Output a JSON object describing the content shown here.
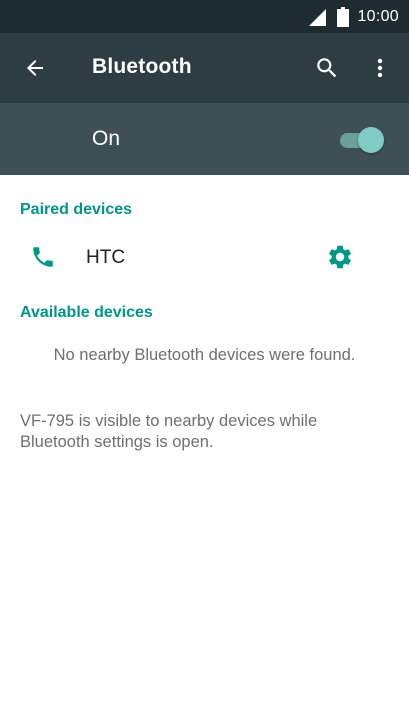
{
  "status_bar": {
    "time": "10:00",
    "icons": [
      "signal-icon",
      "battery-icon"
    ]
  },
  "app_bar": {
    "title": "Bluetooth",
    "icons": [
      "back-arrow-icon",
      "search-icon",
      "more-vert-icon"
    ]
  },
  "master_switch": {
    "label": "On",
    "checked": true
  },
  "paired_devices": {
    "header": "Paired devices",
    "items": [
      {
        "name": "HTC",
        "icon": "phone-icon",
        "action_icon": "gear-icon"
      }
    ]
  },
  "available_devices": {
    "header": "Available devices",
    "empty_message": "No nearby Bluetooth devices were found."
  },
  "footer_message": "VF-795 is visible to nearby devices while Bluetooth settings is open.",
  "colors": {
    "status_bar": "#1e2b30",
    "app_bar": "#2e3d43",
    "switch_bar": "#3e5056",
    "accent": "#009688",
    "toggle_thumb": "#80cbc4"
  }
}
